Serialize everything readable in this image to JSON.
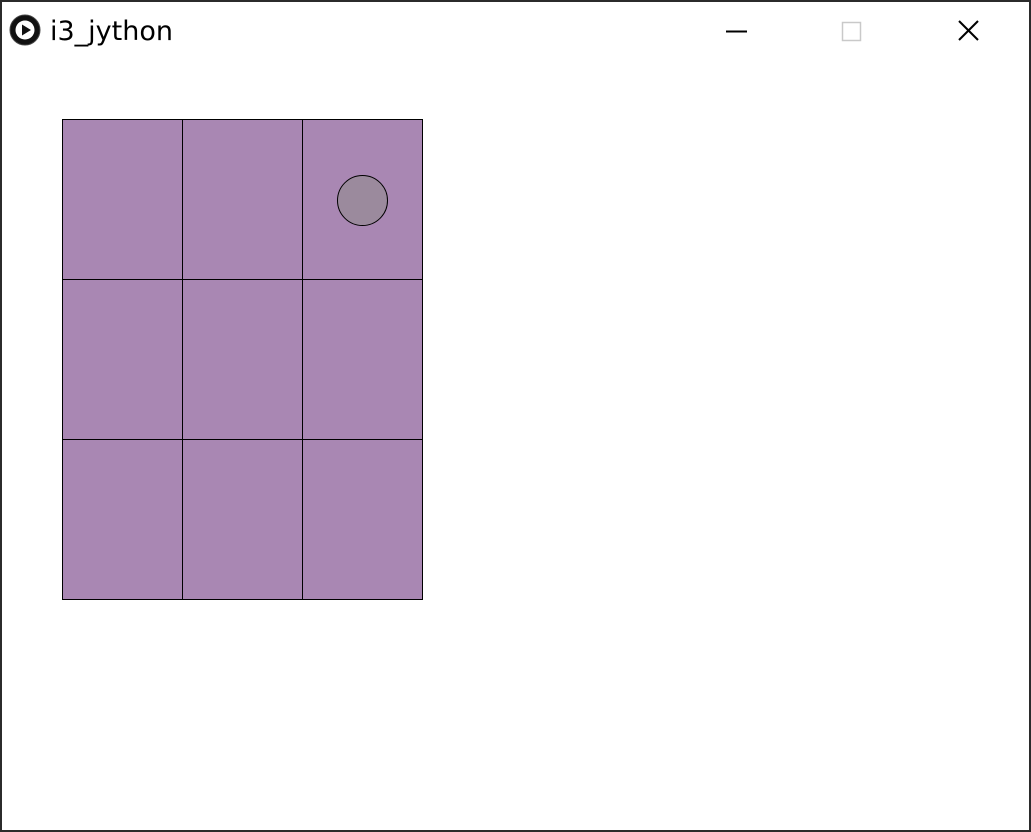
{
  "window": {
    "title": "i3_jython",
    "icon": "processing-play-icon",
    "controls": [
      "minimize-icon",
      "maximize-icon",
      "close-icon"
    ]
  },
  "board": {
    "rows": 3,
    "cols": 3,
    "cell_color": "#a987b3",
    "line_color": "#000000",
    "cells": [
      [
        "",
        "",
        "circle"
      ],
      [
        "",
        "",
        ""
      ],
      [
        "",
        "",
        ""
      ]
    ],
    "piece_color": "#9b8a9d"
  },
  "colors": {
    "background": "#ffffff",
    "frame": "#2b2b2b"
  }
}
